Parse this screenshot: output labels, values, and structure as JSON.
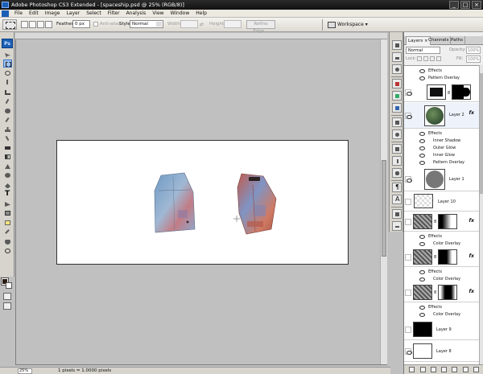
{
  "window": {
    "title": "Adobe Photoshop CS3 Extended - [spaceship.psd @ 25% (RGB/8)]",
    "controls": [
      "_",
      "□",
      "×"
    ]
  },
  "menu": [
    "File",
    "Edit",
    "Image",
    "Layer",
    "Select",
    "Filter",
    "Analysis",
    "View",
    "Window",
    "Help"
  ],
  "options": {
    "feather_label": "Feather:",
    "feather_value": "0 px",
    "antialias_label": "Anti-alias",
    "style_label": "Style:",
    "style_value": "Normal",
    "width_label": "Width:",
    "height_label": "Height:",
    "refine_edge": "Refine Edge...",
    "workspace": "Workspace"
  },
  "tools": {
    "ps_badge": "Ps"
  },
  "status": {
    "zoom": "25%",
    "doc_info": "1 pixels = 1.0000 pixels"
  },
  "layers_panel": {
    "tabs": [
      "Layers",
      "Channels",
      "Paths"
    ],
    "blend_mode": "Normal",
    "opacity_label": "Opacity:",
    "opacity_value": "100%",
    "lock_label": "Lock:",
    "fill_label": "Fill:",
    "fill_value": "100%",
    "rows": [
      {
        "type": "sub",
        "label": "Effects"
      },
      {
        "type": "sub",
        "label": "Pattern Overlay"
      },
      {
        "type": "layer",
        "label": ""
      },
      {
        "type": "layer",
        "label": "Layer 2"
      },
      {
        "type": "sub",
        "label": "Effects"
      },
      {
        "type": "sub",
        "label": "Inner Shadow"
      },
      {
        "type": "sub",
        "label": "Outer Glow"
      },
      {
        "type": "sub",
        "label": "Inner Glow"
      },
      {
        "type": "sub",
        "label": "Pattern Overlay"
      },
      {
        "type": "layer",
        "label": "Layer 1"
      },
      {
        "type": "layer",
        "label": "Layer 10"
      },
      {
        "type": "layer",
        "label": ""
      },
      {
        "type": "sub",
        "label": "Effects"
      },
      {
        "type": "sub",
        "label": "Color Overlay"
      },
      {
        "type": "layer",
        "label": ""
      },
      {
        "type": "sub",
        "label": "Effects"
      },
      {
        "type": "sub",
        "label": "Color Overlay"
      },
      {
        "type": "layer",
        "label": ""
      },
      {
        "type": "sub",
        "label": "Effects"
      },
      {
        "type": "sub",
        "label": "Color Overlay"
      },
      {
        "type": "layer",
        "label": "Layer 9"
      },
      {
        "type": "layer",
        "label": "Layer 8"
      }
    ]
  },
  "colors": {
    "accent": "#1a5fb4",
    "foreground_swatch": "#2b1d14",
    "background_swatch": "#ffffff"
  }
}
